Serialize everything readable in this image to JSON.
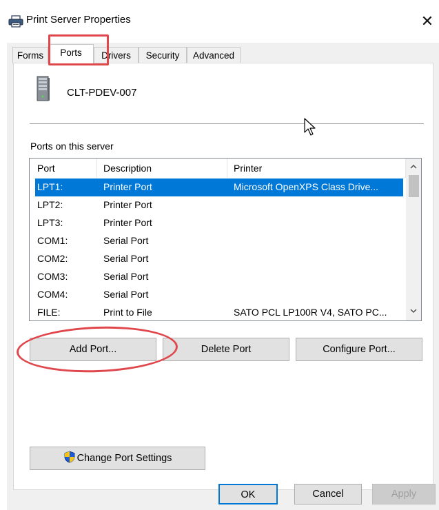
{
  "window": {
    "title": "Print Server Properties",
    "close_glyph": "✕"
  },
  "tabs": [
    {
      "label": "Forms",
      "active": false
    },
    {
      "label": "Ports",
      "active": true
    },
    {
      "label": "Drivers",
      "active": false
    },
    {
      "label": "Security",
      "active": false
    },
    {
      "label": "Advanced",
      "active": false
    }
  ],
  "server": {
    "name": "CLT-PDEV-007",
    "icon": "server-tower-icon"
  },
  "ports_section": {
    "label": "Ports on this server",
    "columns": [
      "Port",
      "Description",
      "Printer"
    ],
    "rows": [
      {
        "port": "LPT1:",
        "description": "Printer Port",
        "printer": "Microsoft OpenXPS Class Drive...",
        "selected": true
      },
      {
        "port": "LPT2:",
        "description": "Printer Port",
        "printer": "",
        "selected": false
      },
      {
        "port": "LPT3:",
        "description": "Printer Port",
        "printer": "",
        "selected": false
      },
      {
        "port": "COM1:",
        "description": "Serial Port",
        "printer": "",
        "selected": false
      },
      {
        "port": "COM2:",
        "description": "Serial Port",
        "printer": "",
        "selected": false
      },
      {
        "port": "COM3:",
        "description": "Serial Port",
        "printer": "",
        "selected": false
      },
      {
        "port": "COM4:",
        "description": "Serial Port",
        "printer": "",
        "selected": false
      },
      {
        "port": "FILE:",
        "description": "Print to File",
        "printer": "SATO PCL LP100R V4, SATO PC...",
        "selected": false
      }
    ]
  },
  "buttons": {
    "add_port": "Add Port...",
    "delete_port": "Delete Port",
    "configure_port": "Configure Port...",
    "change_port_settings": "Change Port Settings",
    "ok": "OK",
    "cancel": "Cancel",
    "apply": "Apply"
  },
  "colors": {
    "selection": "#0078d7",
    "annotation": "#e0474c"
  }
}
